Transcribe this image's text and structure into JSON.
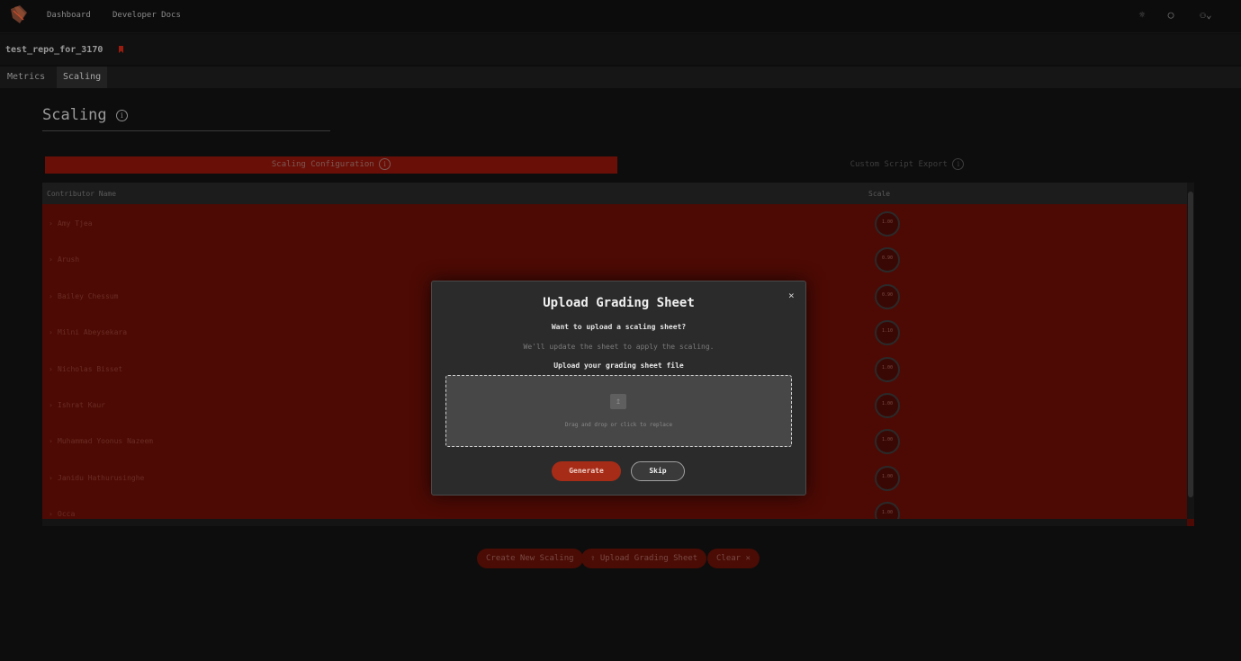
{
  "nav": {
    "dashboard": "Dashboard",
    "docs": "Developer Docs"
  },
  "icons": {
    "logo": "chocolate-logo-icon",
    "theme": "sun-icon",
    "github": "github-icon",
    "user": "user-icon"
  },
  "repo": {
    "name": "test_repo_for_3170"
  },
  "tabs": [
    "Metrics",
    "Scaling"
  ],
  "page": {
    "title": "Scaling"
  },
  "subtabs": {
    "config": "Scaling Configuration",
    "export": "Custom Script Export"
  },
  "table": {
    "headers": {
      "name": "Contributor Name",
      "scale": "Scale"
    },
    "rows": [
      {
        "name": "Amy Tjea",
        "scale": "1.00"
      },
      {
        "name": "Arush",
        "scale": "0.90"
      },
      {
        "name": "Bailey Chessum",
        "scale": "0.90"
      },
      {
        "name": "Milni Abeysekara",
        "scale": "1.10"
      },
      {
        "name": "Nicholas Bisset",
        "scale": "1.00"
      },
      {
        "name": "Ishrat Kaur",
        "scale": "1.00"
      },
      {
        "name": "Muhammad Yoonus Nazeem",
        "scale": "1.00"
      },
      {
        "name": "Janidu Hathurusinghe",
        "scale": "1.00"
      },
      {
        "name": "Occa",
        "scale": "1.00"
      }
    ]
  },
  "bottom": {
    "create": "Create New Scaling",
    "upload": "Upload Grading Sheet",
    "clear": "Clear"
  },
  "modal": {
    "title": "Upload Grading Sheet",
    "question": "Want to upload a scaling sheet?",
    "subtitle": "We'll update the sheet to apply the scaling.",
    "label": "Upload your grading sheet file",
    "dropzone_text": "Drag and drop or click to replace",
    "generate": "Generate",
    "skip": "Skip",
    "close": "×"
  },
  "colors": {
    "accent": "#a62c17",
    "table_bg": "#4d0a04",
    "modal_bg": "#2b2b2b"
  }
}
